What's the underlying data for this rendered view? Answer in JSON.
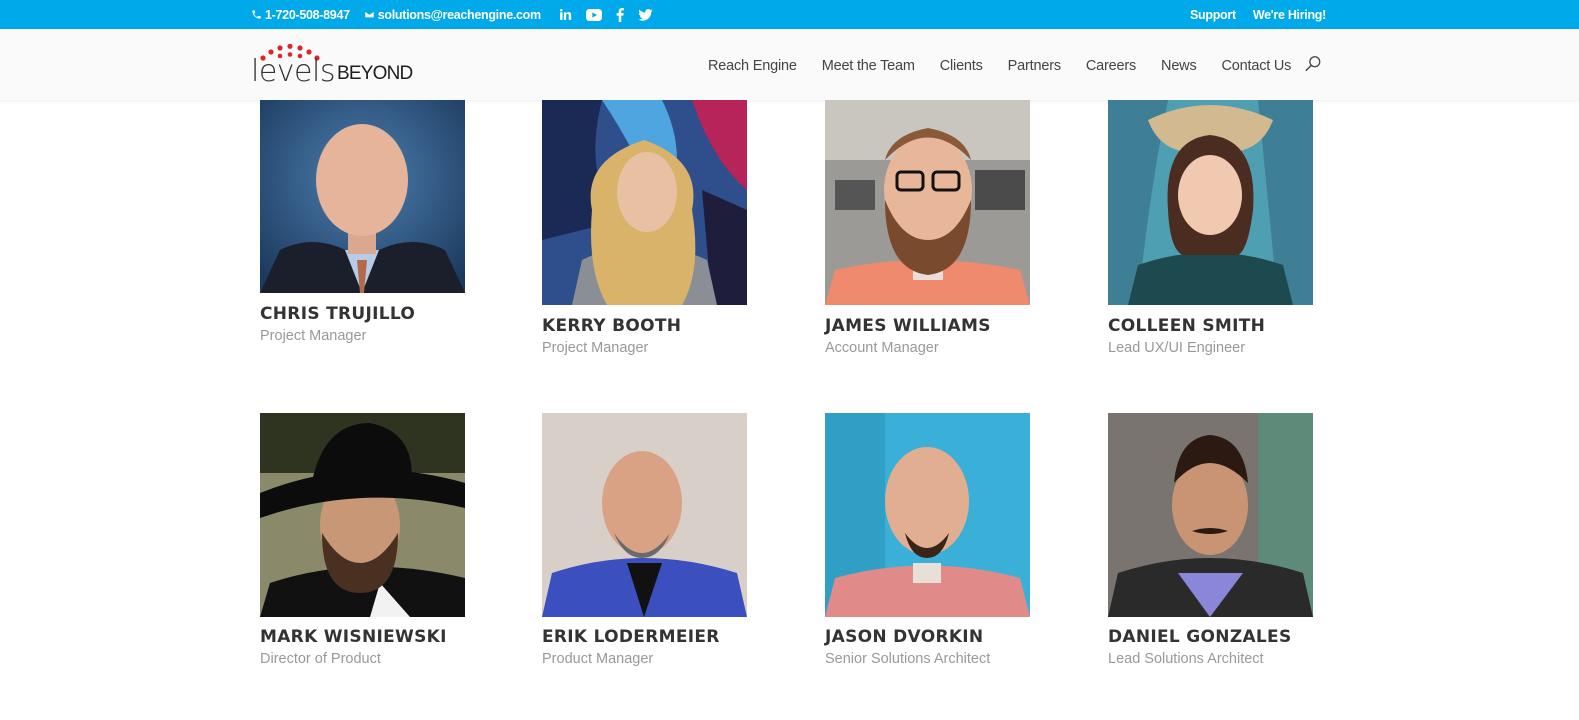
{
  "topbar": {
    "phone": "1-720-508-8947",
    "email": "solutions@reachengine.com",
    "social": [
      "linkedin-icon",
      "youtube-icon",
      "facebook-icon",
      "twitter-icon"
    ],
    "support_label": "Support",
    "hiring_label": "We're Hiring!",
    "bg_color": "#00a9e9"
  },
  "header": {
    "logo_part1": "levels",
    "logo_part2": "BEYOND",
    "logo_dot_color": "#d8282b",
    "nav": [
      "Reach Engine",
      "Meet the Team",
      "Clients",
      "Partners",
      "Careers",
      "News",
      "Contact Us"
    ]
  },
  "team": [
    {
      "name": "CHRIS TRUJILLO",
      "role": "Project Manager"
    },
    {
      "name": "KERRY BOOTH",
      "role": "Project Manager"
    },
    {
      "name": "JAMES WILLIAMS",
      "role": "Account Manager"
    },
    {
      "name": "COLLEEN SMITH",
      "role": "Lead UX/UI Engineer"
    },
    {
      "name": "MARK WISNIEWSKI",
      "role": "Director of Product"
    },
    {
      "name": "ERIK LODERMEIER",
      "role": "Product Manager"
    },
    {
      "name": "JASON DVORKIN",
      "role": "Senior Solutions Architect"
    },
    {
      "name": "DANIEL GONZALES",
      "role": "Lead Solutions Architect"
    }
  ]
}
